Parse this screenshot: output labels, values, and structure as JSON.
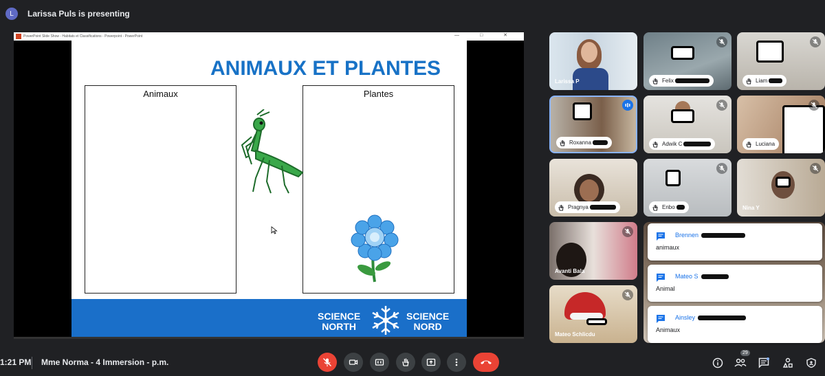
{
  "topbar": {
    "avatar_letter": "L",
    "presenting": "Larissa Puls is presenting"
  },
  "slide": {
    "window_title": "PowerPoint Slide Show - Habitats et Classifications - Powerpoint - PowerPoint",
    "window_controls": "— □ ✕",
    "title": "ANIMAUX ET PLANTES",
    "box_left": "Animaux",
    "box_right": "Plantes",
    "brand_left": [
      "SCIENCE",
      "NORTH"
    ],
    "brand_right": [
      "SCIENCE",
      "NORD"
    ]
  },
  "participants": [
    {
      "name": "Larissa P",
      "style": "plain"
    },
    {
      "name": "Felix",
      "style": "pill"
    },
    {
      "name": "Liam",
      "style": "pill"
    },
    {
      "name": "Roxanna",
      "style": "pill",
      "speaking": true
    },
    {
      "name": "Adwik C",
      "style": "pill"
    },
    {
      "name": "Luciana",
      "style": "pill"
    },
    {
      "name": "Pragnya",
      "style": "pill"
    },
    {
      "name": "Enbo",
      "style": "pill"
    },
    {
      "name": "Nina Y",
      "style": "plain"
    },
    {
      "name": "Avanti Bala",
      "style": "plain"
    },
    {
      "name": "Mateo Schlicdu",
      "style": "plain"
    }
  ],
  "chat": [
    {
      "name": "Brennen",
      "message": "animaux"
    },
    {
      "name": "Mateo S",
      "message": "Animal"
    },
    {
      "name": "Ainsley",
      "message": "Animaux"
    }
  ],
  "bottombar": {
    "time": "1:21 PM",
    "meeting": "Mme Norma - 4 Immersion - p.m.",
    "participant_count": "29"
  },
  "colors": {
    "accent": "#1a73e8",
    "danger": "#ea4335",
    "slide_title": "#1872c6",
    "footer_blue": "#1a6fc9"
  }
}
